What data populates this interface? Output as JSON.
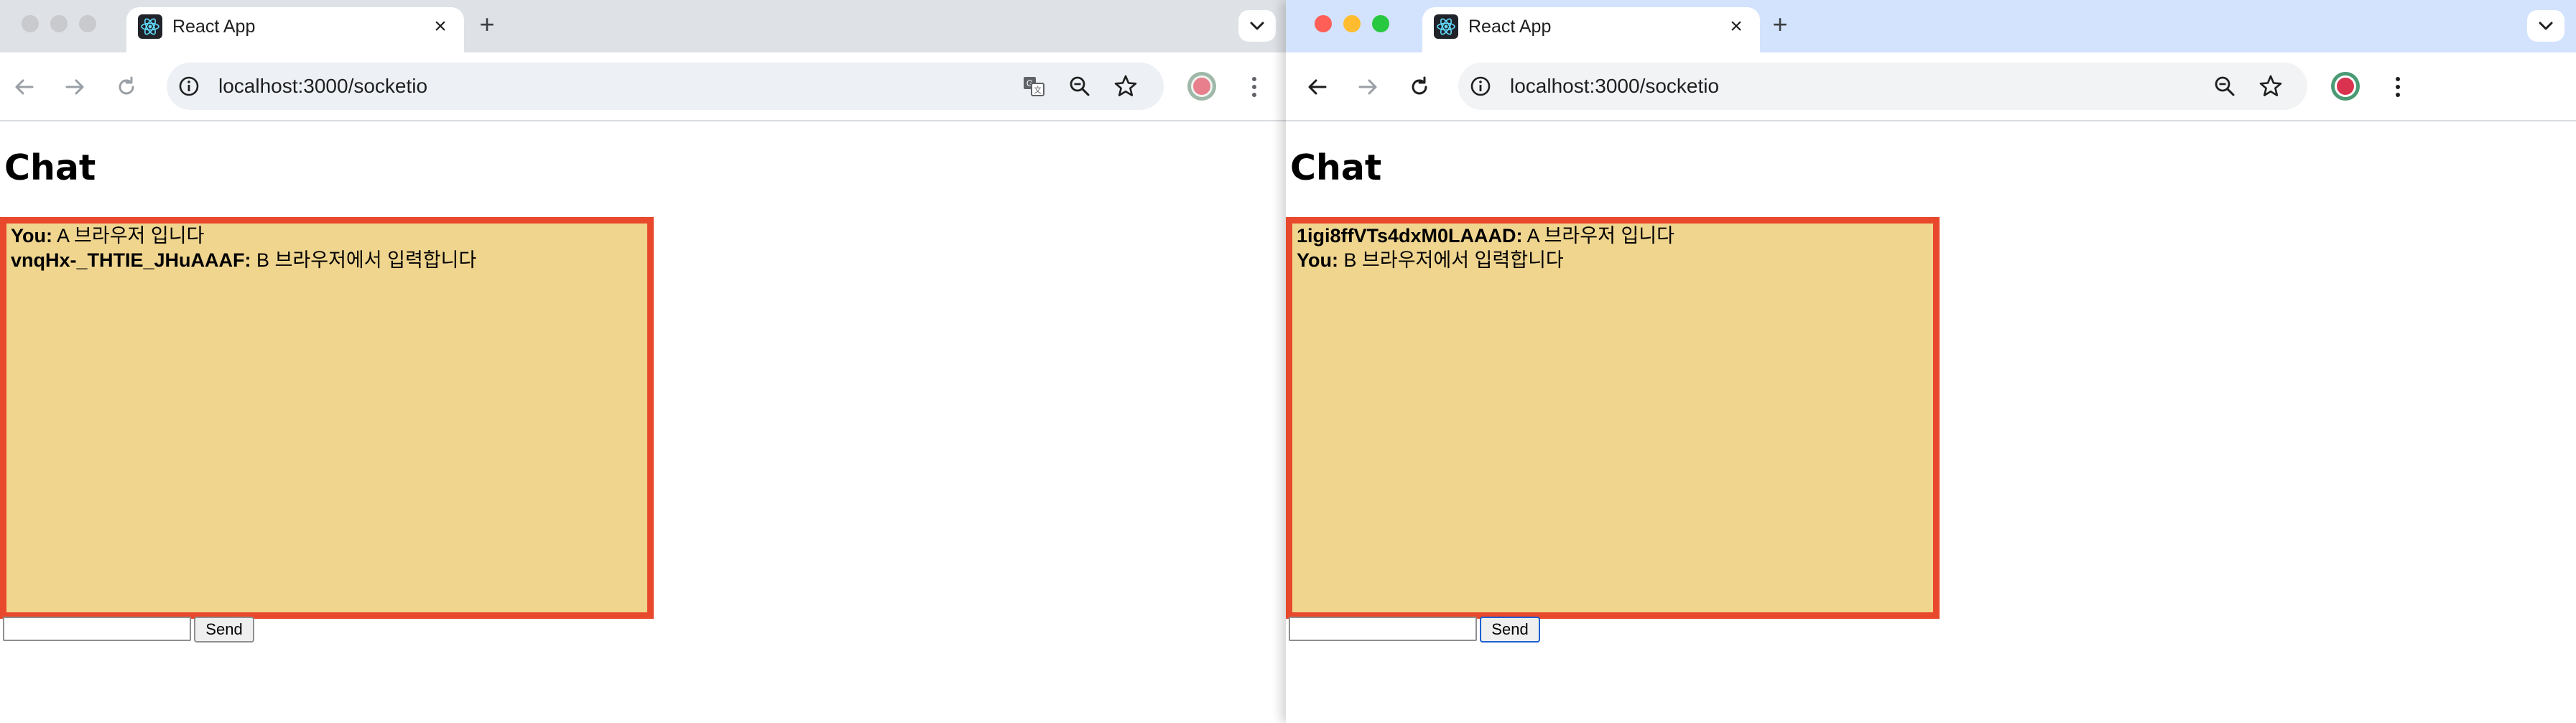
{
  "colors": {
    "chat_box_bg": "#f0d58f",
    "chat_box_border": "#e8482c",
    "tabstrip_left_inactive": "#dee1e6",
    "tabstrip_right_active": "#d3e3fd"
  },
  "windows": [
    {
      "tab": {
        "title": "React App",
        "favicon": "react-icon"
      },
      "address": {
        "url": "localhost:3000/socketio"
      },
      "chat": {
        "heading": "Chat",
        "messages": [
          {
            "sender": "You:",
            "text": "A 브라우저 입니다"
          },
          {
            "sender": "vnqHx-_THTIE_JHuAAAF:",
            "text": "B 브라우저에서 입력합니다"
          }
        ],
        "input_value": "",
        "send_label": "Send"
      }
    },
    {
      "tab": {
        "title": "React App",
        "favicon": "react-icon"
      },
      "address": {
        "url": "localhost:3000/socketio"
      },
      "chat": {
        "heading": "Chat",
        "messages": [
          {
            "sender": "1igi8ffVTs4dxM0LAAAD:",
            "text": "A 브라우저 입니다"
          },
          {
            "sender": "You:",
            "text": "B 브라우저에서 입력합니다"
          }
        ],
        "input_value": "",
        "send_label": "Send"
      }
    }
  ]
}
